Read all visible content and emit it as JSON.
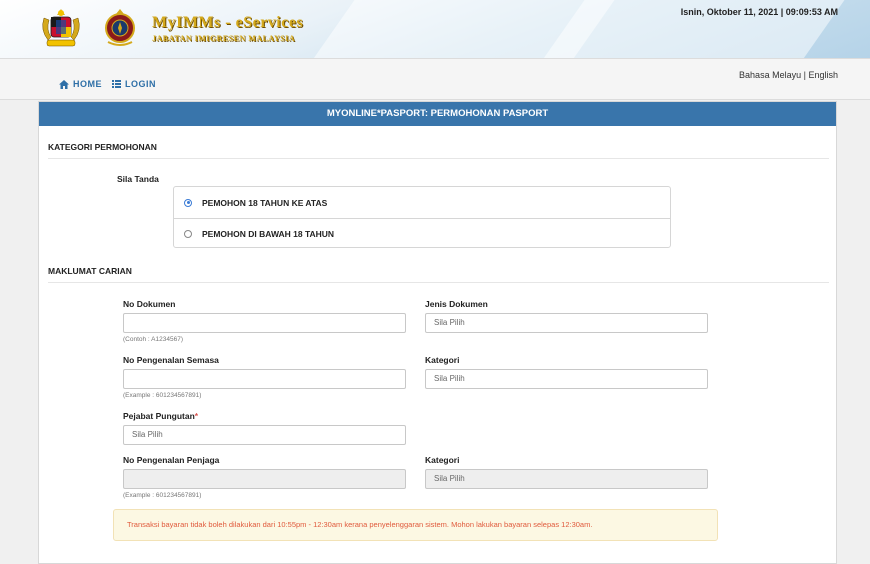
{
  "header": {
    "title": "MyIMMs - eServices",
    "subtitle": "JABATAN IMIGRESEN MALAYSIA",
    "datetime": "Isnin, Oktober 11, 2021 | 09:09:53 AM"
  },
  "nav": {
    "home": "HOME",
    "login": "LOGIN",
    "lang_malay": "Bahasa Melayu",
    "lang_sep": "|",
    "lang_english": "English"
  },
  "panel": {
    "title": "MYONLINE*PASPORT: PERMOHONAN PASPORT"
  },
  "kategori": {
    "heading": "KATEGORI PERMOHONAN",
    "prompt": "Sila Tanda",
    "options": [
      {
        "label": "PEMOHON 18 TAHUN KE ATAS",
        "selected": true
      },
      {
        "label": "PEMOHON DI BAWAH 18 TAHUN",
        "selected": false
      }
    ]
  },
  "carian": {
    "heading": "MAKLUMAT CARIAN",
    "no_dokumen": {
      "label": "No Dokumen",
      "value": "",
      "hint": "(Contoh : A1234567)"
    },
    "jenis_dokumen": {
      "label": "Jenis Dokumen",
      "value": "Sila Pilih"
    },
    "no_pengenalan": {
      "label": "No Pengenalan Semasa",
      "value": "",
      "hint": "(Example : 601234567891)"
    },
    "kategori1": {
      "label": "Kategori",
      "value": "Sila Pilih"
    },
    "pejabat": {
      "label": "Pejabat Pungutan",
      "required": "*",
      "value": "Sila Pilih"
    },
    "no_penjaga": {
      "label": "No Pengenalan Penjaga",
      "value": "",
      "hint": "(Example : 601234567891)"
    },
    "kategori2": {
      "label": "Kategori",
      "value": "Sila Pilih"
    }
  },
  "notice": "Transaksi bayaran tidak boleh dilakukan dari 10:55pm - 12:30am kerana penyelenggaran sistem. Mohon lakukan bayaran selepas 12:30am.",
  "colors": {
    "primary": "#3975ab",
    "link": "#2e6fa7",
    "gold": "#d4a91c",
    "notice_text": "#e05a3c"
  }
}
